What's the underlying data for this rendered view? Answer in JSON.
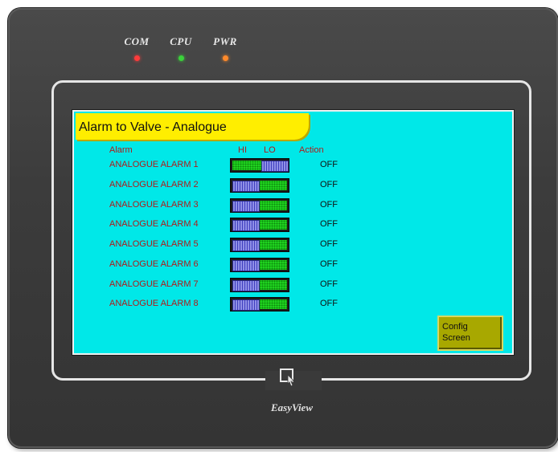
{
  "device": {
    "leds": [
      {
        "label": "COM",
        "color": "#ff3b3b"
      },
      {
        "label": "CPU",
        "color": "#3bd13b"
      },
      {
        "label": "PWR",
        "color": "#ff8a2b"
      }
    ],
    "brand": "EasyView",
    "brand_icon": "pointing-hand-icon"
  },
  "screen": {
    "background": "#00e8e8",
    "title": "Alarm to Valve - Analogue",
    "headers": {
      "alarm": "Alarm",
      "hi": "HI",
      "lo": "LO",
      "action": "Action"
    },
    "rows": [
      {
        "label": "ANALOGUE ALARM 1",
        "switch": "LO",
        "action": "OFF"
      },
      {
        "label": "ANALOGUE ALARM 2",
        "switch": "HI",
        "action": "OFF"
      },
      {
        "label": "ANALOGUE ALARM 3",
        "switch": "HI",
        "action": "OFF"
      },
      {
        "label": "ANALOGUE ALARM 4",
        "switch": "HI",
        "action": "OFF"
      },
      {
        "label": "ANALOGUE ALARM 5",
        "switch": "HI",
        "action": "OFF"
      },
      {
        "label": "ANALOGUE ALARM 6",
        "switch": "HI",
        "action": "OFF"
      },
      {
        "label": "ANALOGUE ALARM 7",
        "switch": "HI",
        "action": "OFF"
      },
      {
        "label": "ANALOGUE ALARM 8",
        "switch": "HI",
        "action": "OFF"
      }
    ],
    "config_button": "Config\nScreen"
  }
}
